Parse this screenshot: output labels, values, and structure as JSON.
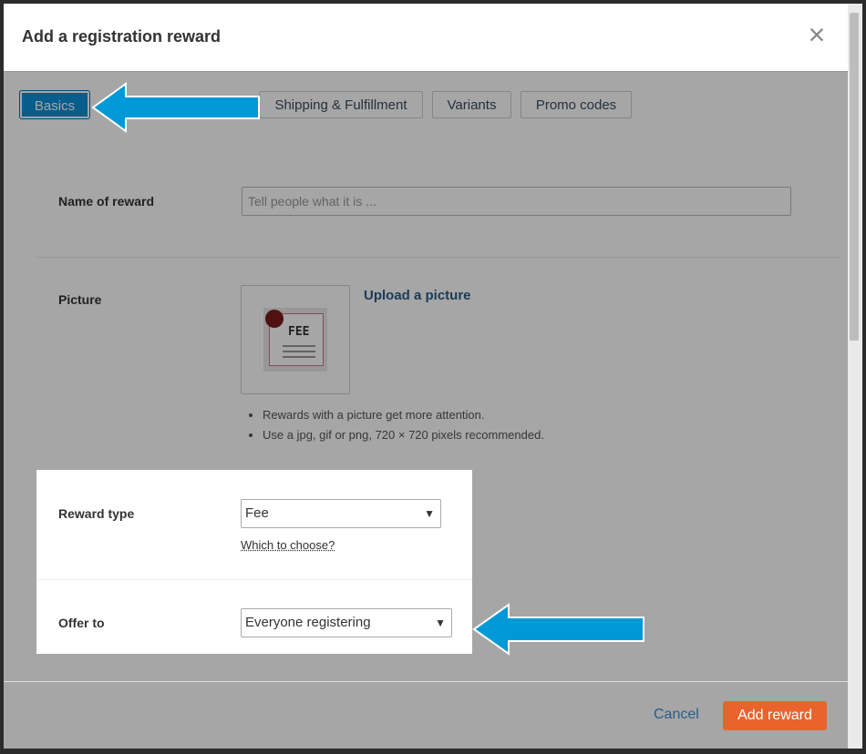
{
  "modal": {
    "title": "Add a registration reward",
    "close_icon": "close-icon"
  },
  "tabs": [
    {
      "label": "Basics",
      "active": true
    },
    {
      "label": "Shipping & Fulfillment",
      "active": false
    },
    {
      "label": "Variants",
      "active": false
    },
    {
      "label": "Promo codes",
      "active": false
    }
  ],
  "form": {
    "name_label": "Name of reward",
    "name_placeholder": "Tell people what it is ...",
    "picture_label": "Picture",
    "upload_label": "Upload a picture",
    "picture_image_text": "FEE",
    "tips": [
      "Rewards with a picture get more attention.",
      "Use a jpg, gif or png, 720 × 720 pixels recommended."
    ],
    "reward_type_label": "Reward type",
    "reward_type_value": "Fee",
    "which_link": "Which to choose?",
    "offer_to_label": "Offer to",
    "offer_to_value": "Everyone registering"
  },
  "footer": {
    "cancel_label": "Cancel",
    "add_label": "Add reward"
  },
  "colors": {
    "accent_blue": "#0b8fd8",
    "arrow_blue": "#0099d8",
    "add_button": "#e8642c",
    "link": "#2a5c8a"
  }
}
